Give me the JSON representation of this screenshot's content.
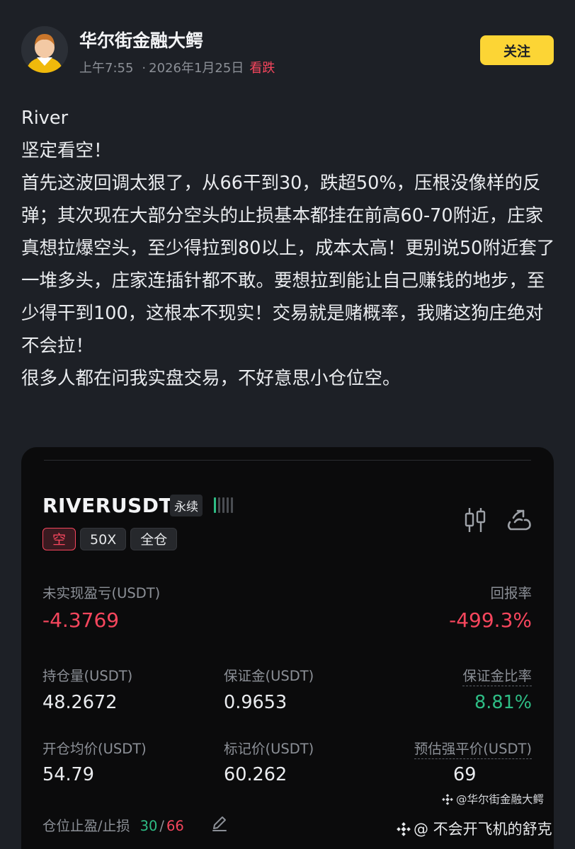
{
  "header": {
    "author": "华尔街金融大鳄",
    "time": "上午7:55",
    "date": "2026年1月25日",
    "sentiment": "看跌",
    "follow_label": "关注"
  },
  "post": {
    "lines": [
      "River",
      "坚定看空！",
      "首先这波回调太狠了，从66干到30，跌超50%，压根没像样的反弹；其次现在大部分空头的止损基本都挂在前高60-70附近，庄家真想拉爆空头，至少得拉到80以上，成本太高！更别说50附近套了一堆多头，庄家连插针都不敢。要想拉到能让自己赚钱的地步，至少得干到100，这根本不现实！交易就是赌概率，我赌这狗庄绝对不会拉！",
      "很多人都在问我实盘交易，不好意思小仓位空。"
    ]
  },
  "card": {
    "symbol": "RIVERUSDT",
    "contract_type": "永续",
    "side": "空",
    "leverage": "50X",
    "margin_mode": "全仓",
    "unrealized_pnl_label": "未实现盈亏(USDT)",
    "unrealized_pnl": "-4.3769",
    "roi_label": "回报率",
    "roi": "-499.3%",
    "position_size_label": "持仓量(USDT)",
    "position_size": "48.2672",
    "margin_label": "保证金(USDT)",
    "margin": "0.9653",
    "margin_ratio_label": "保证金比率",
    "margin_ratio": "8.81%",
    "entry_price_label": "开仓均价(USDT)",
    "entry_price": "54.79",
    "mark_price_label": "标记价(USDT)",
    "mark_price": "60.262",
    "liq_price_label": "预估强平价(USDT)",
    "liq_price": "69",
    "tpsl_label": "仓位止盈/止损",
    "tp": "30",
    "sl": "66",
    "tpsl_sep": "/"
  },
  "watermark": {
    "line1": "@华尔街金融大鳄",
    "line2": "@ 不会开飞机的舒克"
  },
  "colors": {
    "background": "#1d2026",
    "card": "#0b0b0c",
    "accent_yellow": "#fcd535",
    "loss_red": "#f6465d",
    "profit_green": "#2ebd85"
  },
  "icons": [
    "avatar",
    "risk-bars-icon",
    "candlestick-icon",
    "share-icon",
    "edit-icon",
    "binance-logo-icon"
  ]
}
